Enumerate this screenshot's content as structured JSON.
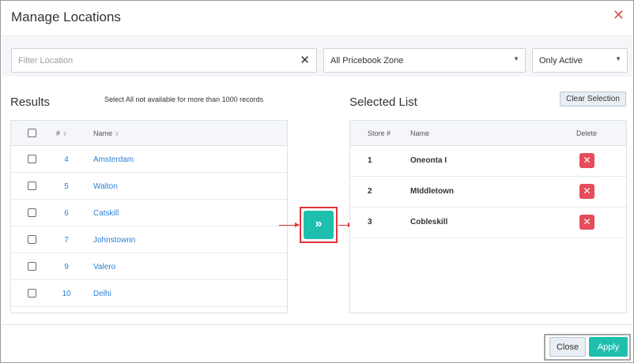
{
  "dialog": {
    "title": "Manage Locations",
    "close_icon": "close-icon"
  },
  "filters": {
    "location_placeholder": "Filter Location",
    "location_value": "",
    "clear_glyph": "✕",
    "pricebook_zone": "All Pricebook Zone",
    "status": "Only Active",
    "caret_glyph": "▼"
  },
  "results": {
    "title": "Results",
    "note": "Select All not available for more than 1000 records",
    "columns": {
      "number": "#",
      "name": "Name"
    },
    "sort_glyph": "⇕",
    "rows": [
      {
        "number": "4",
        "name": "Amsterdam"
      },
      {
        "number": "5",
        "name": "Walton"
      },
      {
        "number": "6",
        "name": "Catskill"
      },
      {
        "number": "7",
        "name": "Johnstownn"
      },
      {
        "number": "9",
        "name": "Valero"
      },
      {
        "number": "10",
        "name": "Delhi"
      }
    ]
  },
  "move": {
    "glyph": "»",
    "icon": "double-chevron-right-icon"
  },
  "selected": {
    "title": "Selected List",
    "clear_label": "Clear Selection",
    "columns": {
      "store": "Store #",
      "name": "Name",
      "delete": "Delete"
    },
    "delete_glyph": "✕",
    "rows": [
      {
        "store": "1",
        "name": "Oneonta I"
      },
      {
        "store": "2",
        "name": "MIddletown"
      },
      {
        "store": "3",
        "name": "Cobleskill"
      }
    ]
  },
  "footer": {
    "close_label": "Close",
    "apply_label": "Apply"
  },
  "colors": {
    "accent": "#1fbfb0",
    "danger": "#e64c5a",
    "link": "#2b7fd4",
    "highlight": "#e0333a"
  }
}
